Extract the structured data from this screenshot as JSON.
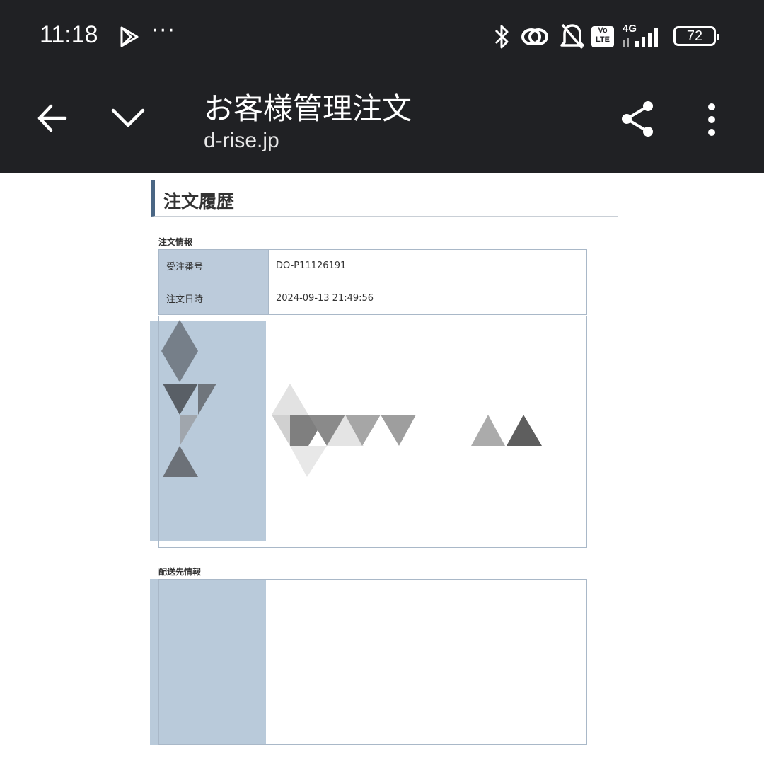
{
  "status_bar": {
    "time": "11:18",
    "more": "···",
    "battery": "72",
    "network": "4G",
    "icons": [
      "play-store-icon",
      "bluetooth-icon",
      "link-icon",
      "bell-off-icon",
      "volte-icon",
      "signal-icon",
      "battery-icon"
    ]
  },
  "toolbar": {
    "title": "お客様管理注文",
    "url": "d-rise.jp",
    "icons": [
      "back-arrow-icon",
      "chevron-down-icon",
      "share-icon",
      "more-vert-icon"
    ]
  },
  "page": {
    "heading": "注文履歴",
    "order_info_label": "注文情報",
    "order_info_rows": [
      {
        "key": "受注番号",
        "value": "DO-P11126191"
      },
      {
        "key": "注文日時",
        "value": "2024-09-13 21:49:56"
      }
    ],
    "shipping_info_label": "配送先情報"
  },
  "colors": {
    "toolbar_bg": "#202124",
    "table_key_bg": "#bccbdb",
    "table_border": "#a9b8c8",
    "heading_accent": "#4a6684"
  }
}
